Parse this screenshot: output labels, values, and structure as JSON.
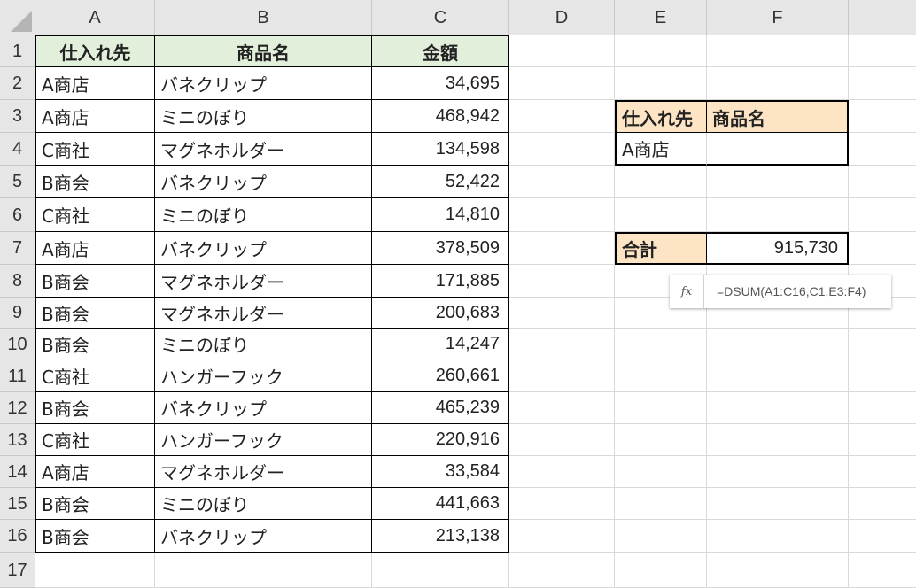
{
  "columns": [
    "A",
    "B",
    "C",
    "D",
    "E",
    "F"
  ],
  "rows": [
    "1",
    "2",
    "3",
    "4",
    "5",
    "6",
    "7",
    "8",
    "9",
    "10",
    "11",
    "12",
    "13",
    "14",
    "15",
    "16",
    "17"
  ],
  "table": {
    "headers": [
      "仕入れ先",
      "商品名",
      "金額"
    ],
    "records": [
      {
        "supplier": "A商店",
        "product": "バネクリップ",
        "amount": "34,695"
      },
      {
        "supplier": "A商店",
        "product": "ミニのぼり",
        "amount": "468,942"
      },
      {
        "supplier": "C商社",
        "product": "マグネホルダー",
        "amount": "134,598"
      },
      {
        "supplier": "B商会",
        "product": "バネクリップ",
        "amount": "52,422"
      },
      {
        "supplier": "C商社",
        "product": "ミニのぼり",
        "amount": "14,810"
      },
      {
        "supplier": "A商店",
        "product": "バネクリップ",
        "amount": "378,509"
      },
      {
        "supplier": "B商会",
        "product": "マグネホルダー",
        "amount": "171,885"
      },
      {
        "supplier": "B商会",
        "product": "マグネホルダー",
        "amount": "200,683"
      },
      {
        "supplier": "B商会",
        "product": "ミニのぼり",
        "amount": "14,247"
      },
      {
        "supplier": "C商社",
        "product": "ハンガーフック",
        "amount": "260,661"
      },
      {
        "supplier": "B商会",
        "product": "バネクリップ",
        "amount": "465,239"
      },
      {
        "supplier": "C商社",
        "product": "ハンガーフック",
        "amount": "220,916"
      },
      {
        "supplier": "A商店",
        "product": "マグネホルダー",
        "amount": "33,584"
      },
      {
        "supplier": "B商会",
        "product": "ミニのぼり",
        "amount": "441,663"
      },
      {
        "supplier": "B商会",
        "product": "バネクリップ",
        "amount": "213,138"
      }
    ]
  },
  "criteria": {
    "headers": [
      "仕入れ先",
      "商品名"
    ],
    "values": [
      "A商店",
      ""
    ]
  },
  "total": {
    "label": "合計",
    "value": "915,730"
  },
  "formula_tooltip": {
    "icon": "fx",
    "text": "=DSUM(A1:C16,C1,E3:F4)"
  },
  "colors": {
    "table_header_bg": "#e2efda",
    "criteria_header_bg": "#fce4c4",
    "header_bg": "#e6e6e6"
  }
}
